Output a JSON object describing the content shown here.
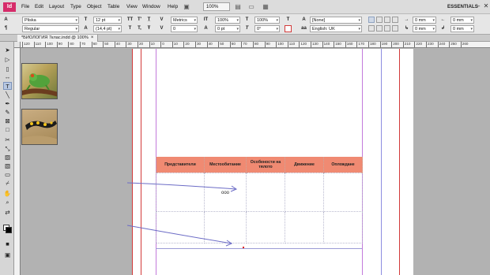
{
  "menubar": {
    "logo": "Id",
    "items": [
      "File",
      "Edit",
      "Layout",
      "Type",
      "Object",
      "Table",
      "View",
      "Window",
      "Help"
    ],
    "zoom": "100%",
    "zoom_percent": "100%",
    "workspace": "ESSENTIALS",
    "window_controls": [
      "–",
      "□",
      "✕"
    ]
  },
  "control_panel": {
    "font_family": "Pliska",
    "font_style": "Regular",
    "font_size": "12 pt",
    "leading": "(14,4 pt)",
    "kerning": "Metrics",
    "tracking": "0",
    "vertical_scale": "100%",
    "horizontal_scale": "100%",
    "baseline_shift": "0 pt",
    "skew": "0°",
    "char_style": "[None]",
    "language": "English: UK",
    "indent_top": "0 mm",
    "indent_bottom": "0 mm",
    "indent_right": "0 mm",
    "indent_left": "0 mm",
    "space_before": "0 mm",
    "space_after": "0 mm",
    "style_labels": [
      "TT",
      "T'",
      "T,",
      "T",
      "Ŧ",
      "T̲"
    ],
    "colors": {
      "accent": "#d62c6a",
      "table_header": "#f08a72",
      "guide_magenta": "#c27adb",
      "guide_violet": "#8c8ce0",
      "guide_red": "#d23a3a",
      "guide_cyan": "#5bb6e6"
    }
  },
  "tab": {
    "title": "*БИОЛОГИЯ 7клас.indd @ 100%",
    "close": "×"
  },
  "ruler": {
    "ticks": [
      "120",
      "110",
      "100",
      "90",
      "80",
      "70",
      "60",
      "50",
      "40",
      "30",
      "20",
      "10",
      "0",
      "10",
      "20",
      "30",
      "40",
      "50",
      "60",
      "70",
      "80",
      "90",
      "100",
      "110",
      "120",
      "130",
      "140",
      "150",
      "160",
      "170",
      "180",
      "190",
      "200",
      "210",
      "220",
      "230",
      "240",
      "250",
      "260"
    ]
  },
  "table": {
    "headers": [
      "Представители",
      "Местообитание",
      "Особености на тялото",
      "Движение",
      "Оплождане"
    ],
    "row1_mark": "ооо"
  },
  "images": [
    {
      "name": "frog-photo",
      "subject": "green tree frog on branch"
    },
    {
      "name": "salamander-photo",
      "subject": "fire salamander on sand"
    }
  ],
  "tools": [
    "selection",
    "direct-selection",
    "page",
    "gap",
    "type",
    "line",
    "pen",
    "pencil",
    "rectangle-frame",
    "rectangle",
    "scissors",
    "free-transform",
    "gradient",
    "gradient-feather",
    "note",
    "eyedropper",
    "hand",
    "zoom"
  ]
}
